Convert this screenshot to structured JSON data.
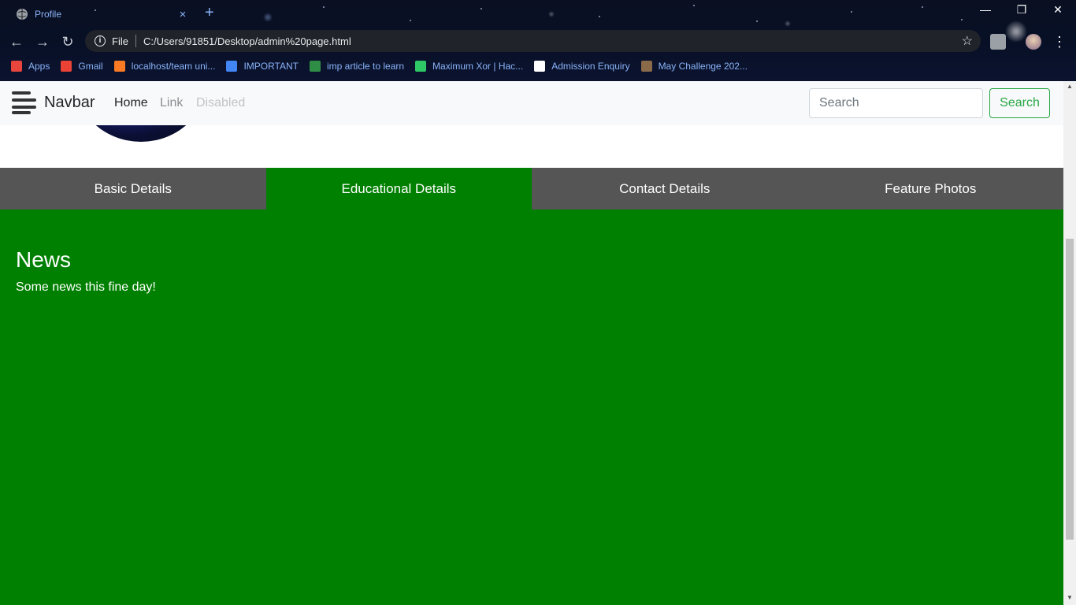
{
  "browser": {
    "tab_title": "Profile",
    "tab_close": "×",
    "new_tab": "+",
    "address_prefix": "File",
    "url": "C:/Users/91851/Desktop/admin%20page.html",
    "window_controls": {
      "minimize": "—",
      "restore": "❐",
      "close": "✕"
    }
  },
  "bookmarks": [
    {
      "label": "Apps",
      "icon": "apps-grid-icon",
      "color": "#e8453c"
    },
    {
      "label": "Gmail",
      "icon": "gmail-icon",
      "color": "#ea4335"
    },
    {
      "label": "localhost/team uni...",
      "icon": "xampp-icon",
      "color": "#fb7a24"
    },
    {
      "label": "IMPORTANT",
      "icon": "tutorial-icon",
      "color": "#4285f4"
    },
    {
      "label": "imp article to learn",
      "icon": "gfg-icon",
      "color": "#2f8d46"
    },
    {
      "label": "Maximum Xor | Hac...",
      "icon": "hackerrank-icon",
      "color": "#2ec866"
    },
    {
      "label": "Admission Enquiry",
      "icon": "globe-icon",
      "color": "#ffffff"
    },
    {
      "label": "May Challenge 202...",
      "icon": "codechef-icon",
      "color": "#8b6a4a"
    }
  ],
  "navbar": {
    "brand": "Navbar",
    "links": {
      "home": "Home",
      "link": "Link",
      "disabled": "Disabled"
    },
    "search_placeholder": "Search",
    "search_button": "Search"
  },
  "profile_tabs": [
    {
      "label": "Basic Details",
      "active": false
    },
    {
      "label": "Educational Details",
      "active": true
    },
    {
      "label": "Contact Details",
      "active": false
    },
    {
      "label": "Feature Photos",
      "active": false
    }
  ],
  "content": {
    "heading": "News",
    "text": "Some news this fine day!"
  },
  "colors": {
    "active_tab": "#008000",
    "inactive_tab": "#555555",
    "search_button": "#28a745"
  }
}
